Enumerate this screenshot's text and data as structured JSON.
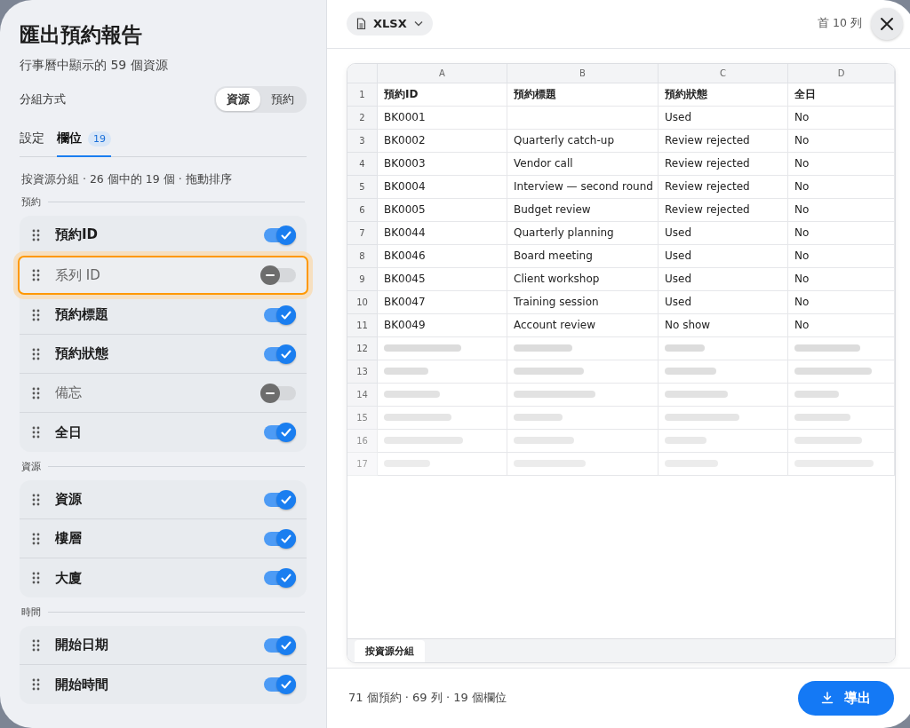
{
  "sidebar": {
    "title": "匯出預約報告",
    "subtitle": "行事曆中顯示的 59 個資源",
    "group_by": {
      "label": "分組方式",
      "options": [
        {
          "label": "資源",
          "selected": true
        },
        {
          "label": "預約",
          "selected": false
        }
      ]
    },
    "tabs": [
      {
        "label": "設定",
        "selected": false
      },
      {
        "label": "欄位",
        "selected": true,
        "badge": "19"
      }
    ],
    "hint": "按資源分組 · 26 個中的 19 個 · 拖動排序",
    "sections": [
      {
        "title": "預約",
        "fields": [
          {
            "label": "預約ID",
            "on": true,
            "highlighted": false
          },
          {
            "label": "系列 ID",
            "on": false,
            "highlighted": true
          },
          {
            "label": "預約標題",
            "on": true,
            "highlighted": false
          },
          {
            "label": "預約狀態",
            "on": true,
            "highlighted": false
          },
          {
            "label": "備忘",
            "on": false,
            "highlighted": false
          },
          {
            "label": "全日",
            "on": true,
            "highlighted": false
          }
        ]
      },
      {
        "title": "資源",
        "fields": [
          {
            "label": "資源",
            "on": true,
            "highlighted": false
          },
          {
            "label": "樓層",
            "on": true,
            "highlighted": false
          },
          {
            "label": "大廈",
            "on": true,
            "highlighted": false
          }
        ]
      },
      {
        "title": "時間",
        "fields": [
          {
            "label": "開始日期",
            "on": true,
            "highlighted": false
          },
          {
            "label": "開始時間",
            "on": true,
            "highlighted": false
          }
        ]
      }
    ]
  },
  "preview": {
    "format": "XLSX",
    "row_note": "首 10 列",
    "sheet": {
      "columns": [
        "A",
        "B",
        "C",
        "D"
      ],
      "rows": [
        {
          "number": "1",
          "kind": "header",
          "cells": [
            "預約ID",
            "預約標題",
            "預約狀態",
            "全日"
          ]
        },
        {
          "number": "2",
          "kind": "data",
          "cells": [
            "BK0001",
            "",
            "Used",
            "No"
          ]
        },
        {
          "number": "3",
          "kind": "data",
          "cells": [
            "BK0002",
            "Quarterly catch-up",
            "Review rejected",
            "No"
          ]
        },
        {
          "number": "4",
          "kind": "data",
          "cells": [
            "BK0003",
            "Vendor call",
            "Review rejected",
            "No"
          ]
        },
        {
          "number": "5",
          "kind": "data",
          "cells": [
            "BK0004",
            "Interview — second round",
            "Review rejected",
            "No"
          ]
        },
        {
          "number": "6",
          "kind": "data",
          "cells": [
            "BK0005",
            "Budget review",
            "Review rejected",
            "No"
          ]
        },
        {
          "number": "7",
          "kind": "data",
          "cells": [
            "BK0044",
            "Quarterly planning",
            "Used",
            "No"
          ]
        },
        {
          "number": "8",
          "kind": "data",
          "cells": [
            "BK0046",
            "Board meeting",
            "Used",
            "No"
          ]
        },
        {
          "number": "9",
          "kind": "data",
          "cells": [
            "BK0045",
            "Client workshop",
            "Used",
            "No"
          ]
        },
        {
          "number": "10",
          "kind": "data",
          "cells": [
            "BK0047",
            "Training session",
            "Used",
            "No"
          ]
        },
        {
          "number": "11",
          "kind": "data",
          "cells": [
            "BK0049",
            "Account review",
            "No show",
            "No"
          ]
        },
        {
          "number": "12",
          "kind": "placeholder"
        },
        {
          "number": "13",
          "kind": "placeholder"
        },
        {
          "number": "14",
          "kind": "placeholder"
        },
        {
          "number": "15",
          "kind": "placeholder"
        },
        {
          "number": "16",
          "kind": "placeholder"
        },
        {
          "number": "17",
          "kind": "placeholder"
        }
      ],
      "sheet_tab": "按資源分組"
    },
    "summary": "71 個預約 · 69 列 · 19 個欄位",
    "export_button": "導出"
  }
}
